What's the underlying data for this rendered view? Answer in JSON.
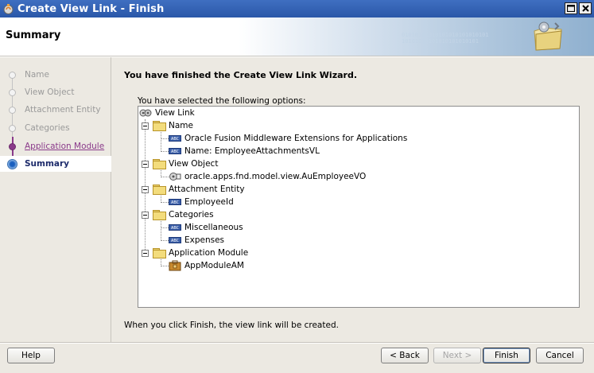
{
  "window": {
    "title": "Create View Link - Finish"
  },
  "header": {
    "page_title": "Summary",
    "binary_text": "01010101010101010101010101\n10101010101010101010101"
  },
  "steps": [
    {
      "label": "Name",
      "state": "pending"
    },
    {
      "label": "View Object",
      "state": "pending"
    },
    {
      "label": "Attachment Entity",
      "state": "pending"
    },
    {
      "label": "Categories",
      "state": "pending"
    },
    {
      "label": "Application Module",
      "state": "visited"
    },
    {
      "label": "Summary",
      "state": "current"
    }
  ],
  "main": {
    "heading": "You have finished the Create View Link Wizard.",
    "options_label": "You have selected the following options:",
    "footer_note": "When you click Finish, the view link will be created."
  },
  "tree": {
    "root": "View Link",
    "groups": [
      {
        "label": "Name",
        "items": [
          "Oracle Fusion Middleware Extensions for Applications",
          "Name: EmployeeAttachmentsVL"
        ]
      },
      {
        "label": "View Object",
        "items": [
          "oracle.apps.fnd.model.view.AuEmployeeVO"
        ]
      },
      {
        "label": "Attachment Entity",
        "items": [
          "EmployeeId"
        ]
      },
      {
        "label": "Categories",
        "items": [
          "Miscellaneous",
          "Expenses"
        ]
      },
      {
        "label": "Application Module",
        "items": [
          "AppModuleAM"
        ]
      }
    ]
  },
  "buttons": {
    "help": "Help",
    "back": "< Back",
    "next": "Next >",
    "finish": "Finish",
    "cancel": "Cancel"
  },
  "colors": {
    "title_bar": "#2a57a8",
    "visited_step": "#8a3a8a",
    "current_step": "#1d2b6b"
  }
}
